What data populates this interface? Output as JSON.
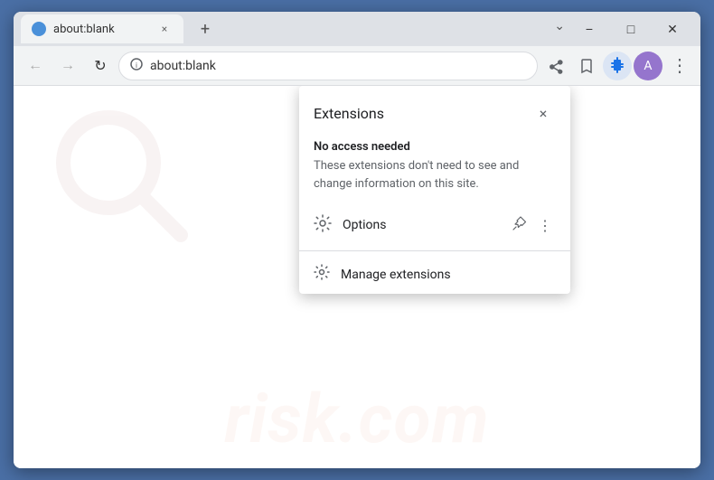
{
  "browser": {
    "tab": {
      "favicon": "●",
      "title": "about:blank",
      "close_label": "×"
    },
    "new_tab_label": "+",
    "chevron": "⌄",
    "address_bar": {
      "url": "about:blank",
      "lock_icon": "⊙"
    },
    "nav": {
      "back": "←",
      "forward": "→",
      "reload": "↻"
    },
    "toolbar": {
      "share_icon": "⬆",
      "bookmark_icon": "☆",
      "extensions_icon": "🧩",
      "profile_icon": "A",
      "more_icon": "⋮"
    },
    "window_controls": {
      "minimize": "−",
      "maximize": "□",
      "close": "✕",
      "restore_down": "⌄"
    }
  },
  "extensions_panel": {
    "title": "Extensions",
    "close_icon": "×",
    "section_no_access": {
      "label": "No access needed",
      "description": "These extensions don't need to see and change information on this site."
    },
    "ext_item": {
      "icon": "⚙",
      "label": "Options",
      "pin_icon": "⊥",
      "more_icon": "⋮"
    },
    "manage_item": {
      "icon": "⚙",
      "label": "Manage extensions"
    }
  },
  "watermark": {
    "text": "risk.com"
  }
}
